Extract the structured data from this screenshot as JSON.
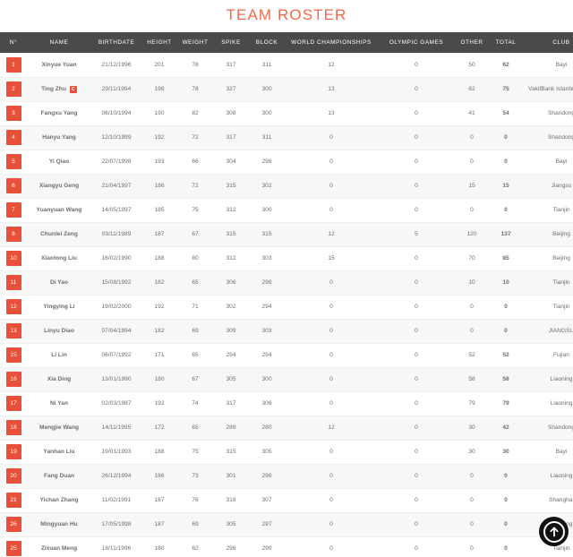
{
  "page": {
    "title": "TEAM ROSTER",
    "title_color": "#ef6a4b",
    "header_bg": "#4a4a4a",
    "badge_color": "#e8503a"
  },
  "scroll_top_button": {
    "icon": "arrow-up-circle-icon",
    "label": "Scroll to top"
  },
  "table": {
    "columns": [
      {
        "key": "num",
        "label": "N°"
      },
      {
        "key": "name",
        "label": "NAME"
      },
      {
        "key": "birth",
        "label": "BIRTHDATE"
      },
      {
        "key": "height",
        "label": "HEIGHT"
      },
      {
        "key": "weight",
        "label": "WEIGHT"
      },
      {
        "key": "spike",
        "label": "SPIKE"
      },
      {
        "key": "block",
        "label": "BLOCK"
      },
      {
        "key": "wch",
        "label": "WORLD CHAMPIONSHIPS"
      },
      {
        "key": "og",
        "label": "OLYMPIC GAMES"
      },
      {
        "key": "other",
        "label": "OTHER"
      },
      {
        "key": "total",
        "label": "TOTAL"
      },
      {
        "key": "club",
        "label": "CLUB"
      }
    ],
    "rows": [
      {
        "num": "1",
        "name": "Xinyue Yuan",
        "captain": "",
        "birth": "21/12/1996",
        "height": "201",
        "weight": "78",
        "spike": "317",
        "block": "311",
        "wch": "12",
        "og": "0",
        "other": "50",
        "total": "62",
        "club": "Bayi"
      },
      {
        "num": "2",
        "name": "Ting Zhu",
        "captain": "C",
        "birth": "29/11/1994",
        "height": "198",
        "weight": "78",
        "spike": "327",
        "block": "300",
        "wch": "13",
        "og": "0",
        "other": "62",
        "total": "75",
        "club": "VakifBank Istanbul (TUR)"
      },
      {
        "num": "3",
        "name": "Fangxu Yang",
        "captain": "",
        "birth": "06/10/1994",
        "height": "190",
        "weight": "82",
        "spike": "308",
        "block": "300",
        "wch": "13",
        "og": "0",
        "other": "41",
        "total": "54",
        "club": "Shandong"
      },
      {
        "num": "4",
        "name": "Hanyu Yang",
        "captain": "",
        "birth": "12/10/1999",
        "height": "192",
        "weight": "72",
        "spike": "317",
        "block": "311",
        "wch": "0",
        "og": "0",
        "other": "0",
        "total": "0",
        "club": "Shandong"
      },
      {
        "num": "5",
        "name": "Yi Qiao",
        "captain": "",
        "birth": "22/07/1998",
        "height": "193",
        "weight": "66",
        "spike": "304",
        "block": "298",
        "wch": "0",
        "og": "0",
        "other": "0",
        "total": "0",
        "club": "Bayi"
      },
      {
        "num": "6",
        "name": "Xiangyu Geng",
        "captain": "",
        "birth": "21/04/1997",
        "height": "186",
        "weight": "72",
        "spike": "315",
        "block": "302",
        "wch": "0",
        "og": "0",
        "other": "15",
        "total": "15",
        "club": "Jiangsu"
      },
      {
        "num": "7",
        "name": "Yuanyuan Wang",
        "captain": "",
        "birth": "14/05/1997",
        "height": "185",
        "weight": "75",
        "spike": "312",
        "block": "300",
        "wch": "0",
        "og": "0",
        "other": "0",
        "total": "0",
        "club": "Tianjin"
      },
      {
        "num": "8",
        "name": "Chunlei Zeng",
        "captain": "",
        "birth": "03/11/1989",
        "height": "187",
        "weight": "67",
        "spike": "315",
        "block": "315",
        "wch": "12",
        "og": "5",
        "other": "120",
        "total": "137",
        "club": "Beijing"
      },
      {
        "num": "10",
        "name": "Xiaotong Liu",
        "captain": "",
        "birth": "16/02/1990",
        "height": "188",
        "weight": "80",
        "spike": "312",
        "block": "303",
        "wch": "15",
        "og": "0",
        "other": "70",
        "total": "85",
        "club": "Beijing"
      },
      {
        "num": "11",
        "name": "Di Yao",
        "captain": "",
        "birth": "15/08/1992",
        "height": "182",
        "weight": "65",
        "spike": "306",
        "block": "298",
        "wch": "0",
        "og": "0",
        "other": "10",
        "total": "10",
        "club": "Tianjin"
      },
      {
        "num": "12",
        "name": "Yingying Li",
        "captain": "",
        "birth": "19/02/2000",
        "height": "192",
        "weight": "71",
        "spike": "302",
        "block": "294",
        "wch": "0",
        "og": "0",
        "other": "0",
        "total": "0",
        "club": "Tianjin"
      },
      {
        "num": "13",
        "name": "Linyu Diao",
        "captain": "",
        "birth": "07/04/1994",
        "height": "182",
        "weight": "69",
        "spike": "309",
        "block": "303",
        "wch": "0",
        "og": "0",
        "other": "0",
        "total": "0",
        "club": "JIANGSU"
      },
      {
        "num": "15",
        "name": "Li Lin",
        "captain": "",
        "birth": "06/07/1992",
        "height": "171",
        "weight": "65",
        "spike": "294",
        "block": "294",
        "wch": "0",
        "og": "0",
        "other": "52",
        "total": "52",
        "club": "Fujian"
      },
      {
        "num": "16",
        "name": "Xia Ding",
        "captain": "",
        "birth": "13/01/1990",
        "height": "180",
        "weight": "67",
        "spike": "305",
        "block": "300",
        "wch": "0",
        "og": "0",
        "other": "58",
        "total": "58",
        "club": "Liaoning"
      },
      {
        "num": "17",
        "name": "Ni Yan",
        "captain": "",
        "birth": "02/03/1987",
        "height": "192",
        "weight": "74",
        "spike": "317",
        "block": "306",
        "wch": "0",
        "og": "0",
        "other": "79",
        "total": "79",
        "club": "Liaoning"
      },
      {
        "num": "18",
        "name": "Mengjie Wang",
        "captain": "",
        "birth": "14/11/1995",
        "height": "172",
        "weight": "65",
        "spike": "289",
        "block": "280",
        "wch": "12",
        "og": "0",
        "other": "30",
        "total": "42",
        "club": "Shandong"
      },
      {
        "num": "19",
        "name": "Yanhan Liu",
        "captain": "",
        "birth": "19/01/1993",
        "height": "188",
        "weight": "75",
        "spike": "315",
        "block": "305",
        "wch": "0",
        "og": "0",
        "other": "30",
        "total": "30",
        "club": "Bayi"
      },
      {
        "num": "20",
        "name": "Fang Duan",
        "captain": "",
        "birth": "26/12/1994",
        "height": "186",
        "weight": "73",
        "spike": "301",
        "block": "296",
        "wch": "0",
        "og": "0",
        "other": "0",
        "total": "0",
        "club": "Liaoning"
      },
      {
        "num": "21",
        "name": "Yichan Zhang",
        "captain": "",
        "birth": "11/02/1991",
        "height": "187",
        "weight": "76",
        "spike": "318",
        "block": "307",
        "wch": "0",
        "og": "0",
        "other": "0",
        "total": "0",
        "club": "Shanghai"
      },
      {
        "num": "26",
        "name": "Mingyuan Hu",
        "captain": "",
        "birth": "17/05/1998",
        "height": "187",
        "weight": "69",
        "spike": "305",
        "block": "297",
        "wch": "0",
        "og": "0",
        "other": "0",
        "total": "0",
        "club": "Liaoning"
      },
      {
        "num": "25",
        "name": "Zixuan Meng",
        "captain": "",
        "birth": "18/11/1996",
        "height": "180",
        "weight": "62",
        "spike": "298",
        "block": "290",
        "wch": "0",
        "og": "0",
        "other": "0",
        "total": "0",
        "club": "Tianjin"
      }
    ]
  }
}
